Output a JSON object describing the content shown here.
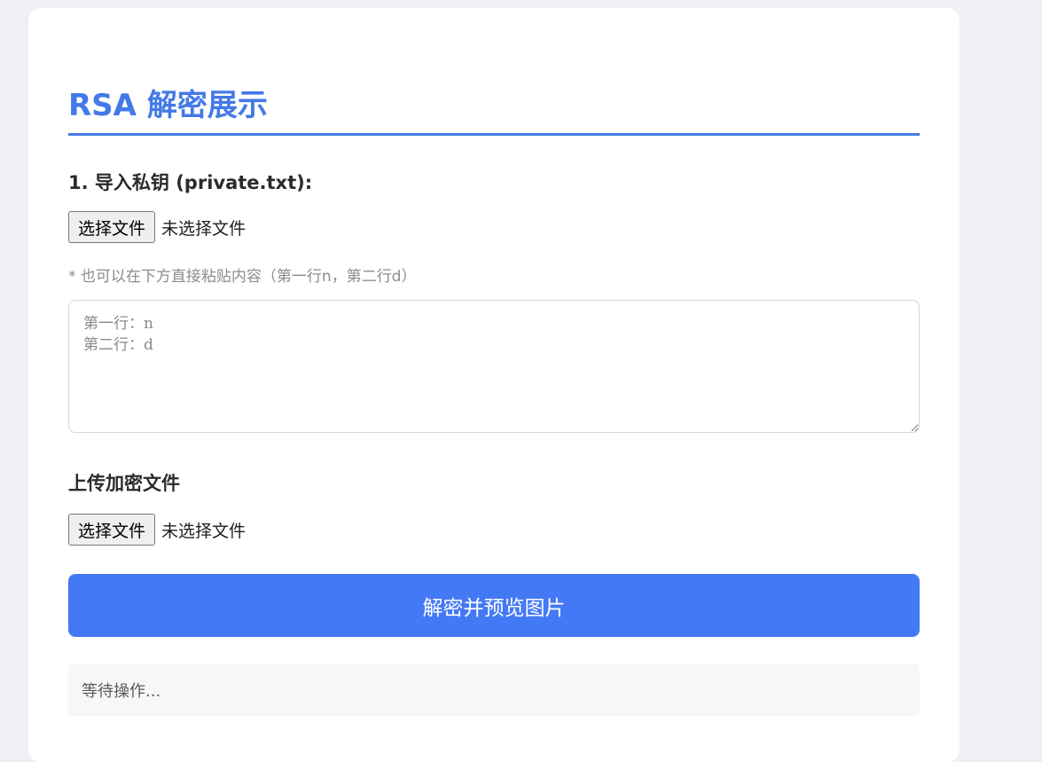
{
  "page": {
    "title": "RSA 解密展示"
  },
  "private_key": {
    "label": "1. 导入私钥 (private.txt):",
    "file_button": "选择文件",
    "file_status": "未选择文件",
    "hint": "* 也可以在下方直接粘贴内容（第一行n，第二行d）",
    "textarea_placeholder": "第一行：n\n第二行：d"
  },
  "encrypted_file": {
    "label": "上传加密文件",
    "file_button": "选择文件",
    "file_status": "未选择文件"
  },
  "actions": {
    "decrypt_label": "解密并预览图片"
  },
  "status": {
    "text": "等待操作..."
  },
  "colors": {
    "accent": "#4479e8",
    "button": "#4479f5",
    "background": "#eef0f4"
  }
}
